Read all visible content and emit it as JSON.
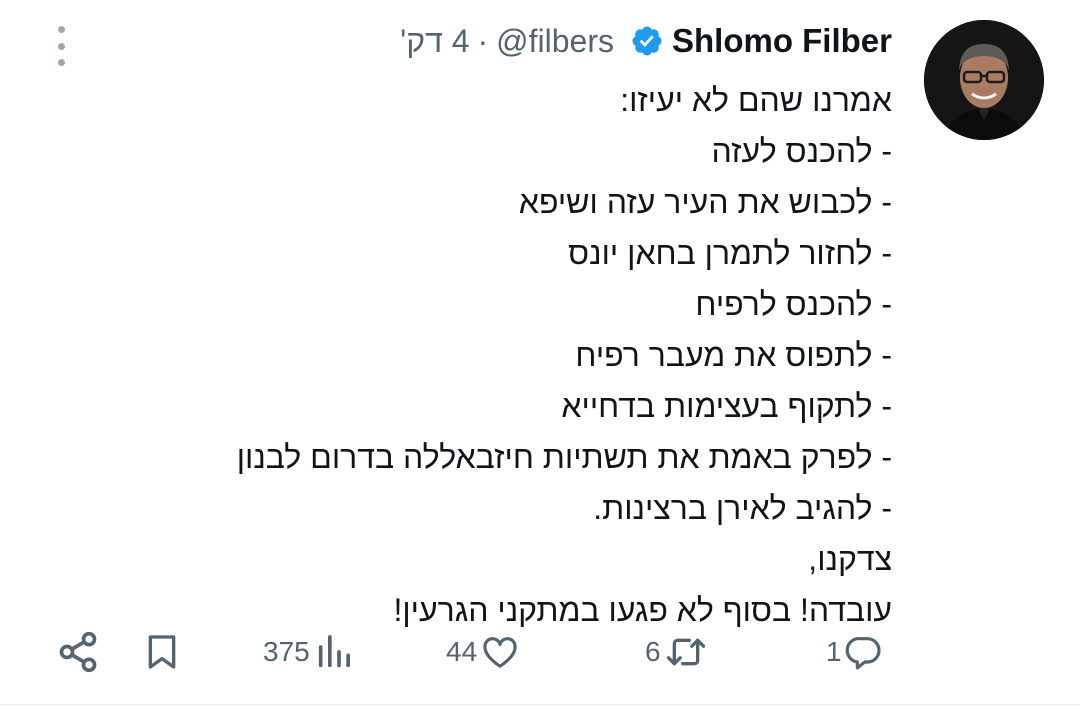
{
  "tweet": {
    "author_name": "Shlomo Filber",
    "handle": "@filbers",
    "separator": "·",
    "time": "4 דק'",
    "lines": [
      "אמרנו שהם לא יעיזו:",
      "- להכנס לעזה",
      "- לכבוש את העיר עזה ושיפא",
      "- לחזור לתמרן בחאן יונס",
      "- להכנס לרפיח",
      "- לתפוס את מעבר רפיח",
      "- לתקוף בעצימות בדחייא",
      "- לפרק באמת את תשתיות חיזבאללה בדרום לבנון",
      "- להגיב לאירן ברצינות.",
      "צדקנו,",
      "עובדה! בסוף לא פגעו במתקני הגרעין!"
    ]
  },
  "actions": {
    "replies": "1",
    "retweets": "6",
    "likes": "44",
    "views": "375"
  },
  "icons": [
    "more-vertical-icon",
    "verified-badge-icon",
    "reply-icon",
    "retweet-icon",
    "like-icon",
    "views-icon",
    "bookmark-icon",
    "share-icon"
  ],
  "colors": {
    "verified": "#1d9bf0",
    "secondary_text": "#536471",
    "text": "#0f1419"
  }
}
